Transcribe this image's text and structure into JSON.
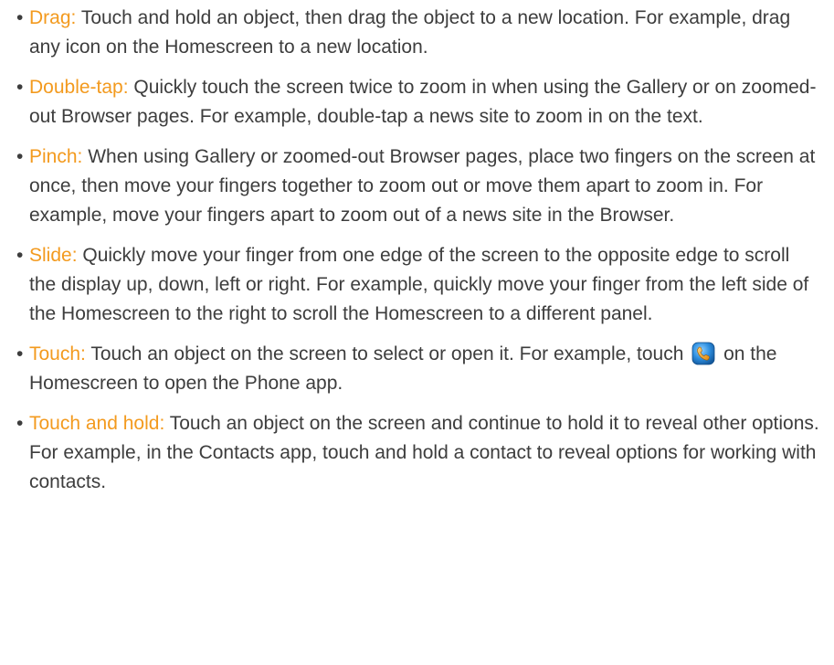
{
  "bullet_glyph": "•",
  "accent_color": "#f39a1e",
  "text_color": "#3d3d3d",
  "gestures": [
    {
      "term": "Drag:",
      "text": " Touch and hold an object, then drag the object to a new location. For example, drag any icon on the Homescreen to a new location."
    },
    {
      "term": "Double-tap:",
      "text": " Quickly touch the screen twice to zoom in when using the Gallery or on zoomed-out Browser pages. For example, double-tap a news site to zoom in on the text."
    },
    {
      "term": "Pinch:",
      "text": " When using Gallery or zoomed-out Browser pages, place two fingers on the screen at once, then move your fingers together to zoom out or move them apart to zoom in. For example, move your fingers apart to zoom out of a news site in the Browser."
    },
    {
      "term": "Slide:",
      "text": " Quickly move your finger from one edge of the screen to the opposite edge to scroll the display up, down, left or right. For example, quickly move your finger from the left side of the Homescreen to the right to scroll the Homescreen to a different panel."
    },
    {
      "term": "Touch:",
      "text_before_icon": " Touch an object on the screen to select or open it. For example, touch",
      "icon": "phone-app-icon",
      "text_after_icon": "on the Homescreen to open the Phone app."
    },
    {
      "term": "Touch and hold:",
      "text": " Touch an object on the screen and continue to hold it to reveal other options. For example, in the Contacts app, touch and hold a contact to reveal options for working with contacts."
    }
  ]
}
